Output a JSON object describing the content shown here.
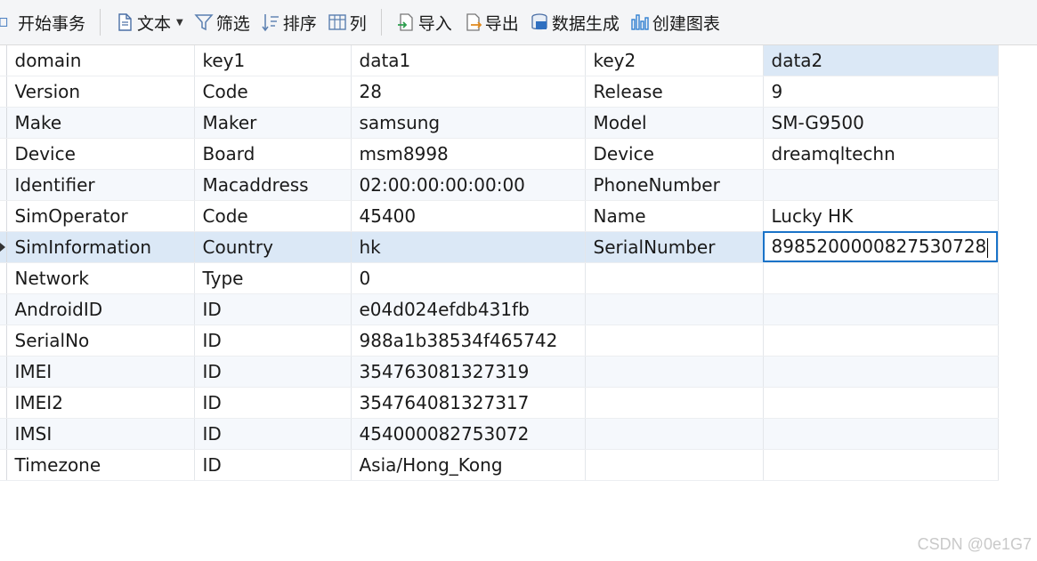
{
  "toolbar": {
    "begin_transaction": "开始事务",
    "text": "文本",
    "filter": "筛选",
    "sort": "排序",
    "columns": "列",
    "import": "导入",
    "export": "导出",
    "data_generate": "数据生成",
    "create_chart": "创建图表"
  },
  "grid": {
    "headers": [
      "domain",
      "key1",
      "data1",
      "key2",
      "data2"
    ],
    "rows": [
      [
        "Version",
        "Code",
        "28",
        "Release",
        "9"
      ],
      [
        "Make",
        "Maker",
        "samsung",
        "Model",
        "SM-G9500"
      ],
      [
        "Device",
        "Board",
        "msm8998",
        "Device",
        "dreamqltechn"
      ],
      [
        "Identifier",
        "Macaddress",
        "02:00:00:00:00:00",
        "PhoneNumber",
        ""
      ],
      [
        "SimOperator",
        "Code",
        "45400",
        "Name",
        "Lucky HK"
      ],
      [
        "SimInformation",
        "Country",
        "hk",
        "SerialNumber",
        "89852000008275307​28"
      ],
      [
        "Network",
        "Type",
        "0",
        "",
        ""
      ],
      [
        "AndroidID",
        "ID",
        "e04d024efdb431fb",
        "",
        ""
      ],
      [
        "SerialNo",
        "ID",
        "988a1b38534f465742",
        "",
        ""
      ],
      [
        "IMEI",
        "ID",
        "354763081327319",
        "",
        ""
      ],
      [
        "IMEI2",
        "ID",
        "354764081327317",
        "",
        ""
      ],
      [
        "IMSI",
        "ID",
        "454000082753072",
        "",
        ""
      ],
      [
        "Timezone",
        "ID",
        "Asia/Hong_Kong",
        "",
        ""
      ]
    ]
  },
  "watermark": "CSDN @0e1G7",
  "colors": {
    "selected_row": "#dbe8f6",
    "alt_row": "#f5f8fc",
    "edit_border": "#1a73c8"
  }
}
